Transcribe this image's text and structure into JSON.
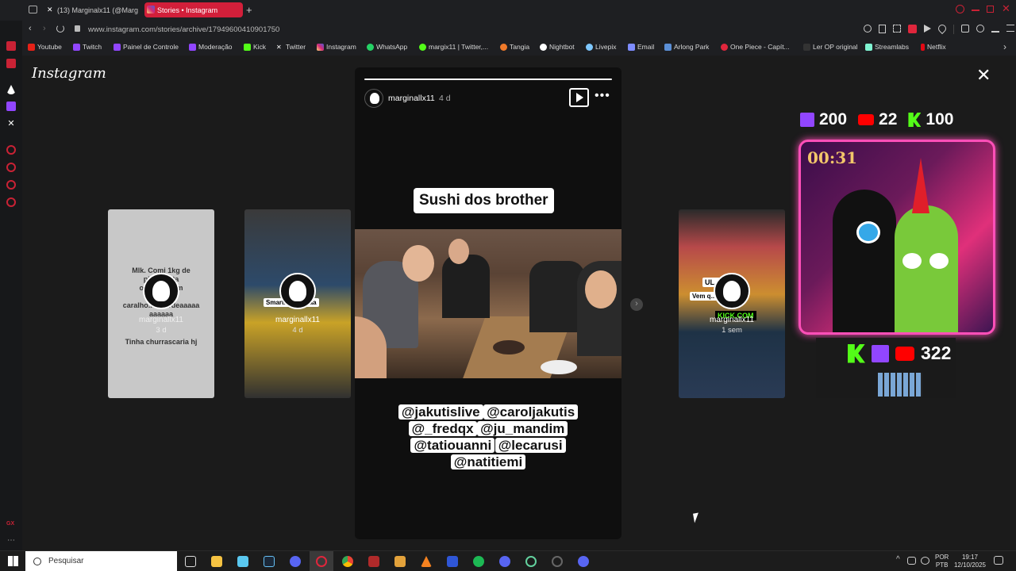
{
  "tabs": [
    {
      "label": "(13) Marginalx11 (@Margi"
    },
    {
      "label": "Stories • Instagram"
    }
  ],
  "address": {
    "url": "www.instagram.com/stories/archive/17949600410901750"
  },
  "bookmarks": [
    "Youtube",
    "Twitch",
    "Painel de Controle",
    "Moderação",
    "Kick",
    "Twitter",
    "Instagram",
    "WhatsApp",
    "margix11 | Twitter,...",
    "Tangia",
    "Nightbot",
    "Livepix",
    "Email",
    "Arlong Park",
    "One Piece - Capít...",
    "Ler OP original",
    "Streamlabs",
    "Netflix"
  ],
  "instagram": {
    "logo": "Instagram"
  },
  "previews": [
    {
      "name": "marginallx11",
      "date": "3 d",
      "text_lines": [
        "Mlk. Comi 1kg de",
        "pip...   ...nta",
        "onte...      ...i um",
        "monte",
        "caralho.... merdeaaaaa",
        "aaaaaa"
      ],
      "footer": "Tinha churrascaria hj"
    },
    {
      "name": "marginallx11",
      "date": "4 d",
      "label": "Smarti...   ...onaaa"
    },
    {
      "name": "marginallx11",
      "date": "1 sem",
      "lines": [
        "UL...   ...VE",
        "Vem q...    ...car pq",
        "KICK.COM"
      ]
    }
  ],
  "story": {
    "username": "marginallx11",
    "time": "4 d",
    "caption": "Sushi dos brother",
    "tags": [
      [
        "@jakutislive",
        "@caroljakutis"
      ],
      [
        "@_fredqx",
        "@ju_mandim"
      ],
      [
        "@tatiouanni",
        "@lecarusi"
      ],
      [
        "@natitiemi"
      ]
    ]
  },
  "overlay": {
    "twitch_count": "200",
    "youtube_count": "22",
    "kick_count": "100",
    "timer": "00:31",
    "total": "322"
  },
  "taskbar": {
    "search_placeholder": "Pesquisar",
    "lang_top": "POR",
    "lang_bottom": "PTB",
    "time": "19:17",
    "date": "12/10/2025"
  },
  "colors": {
    "accent": "#e01f3d",
    "story_bg": "#0f0f0f",
    "ig_bg": "#1b1b1b"
  }
}
